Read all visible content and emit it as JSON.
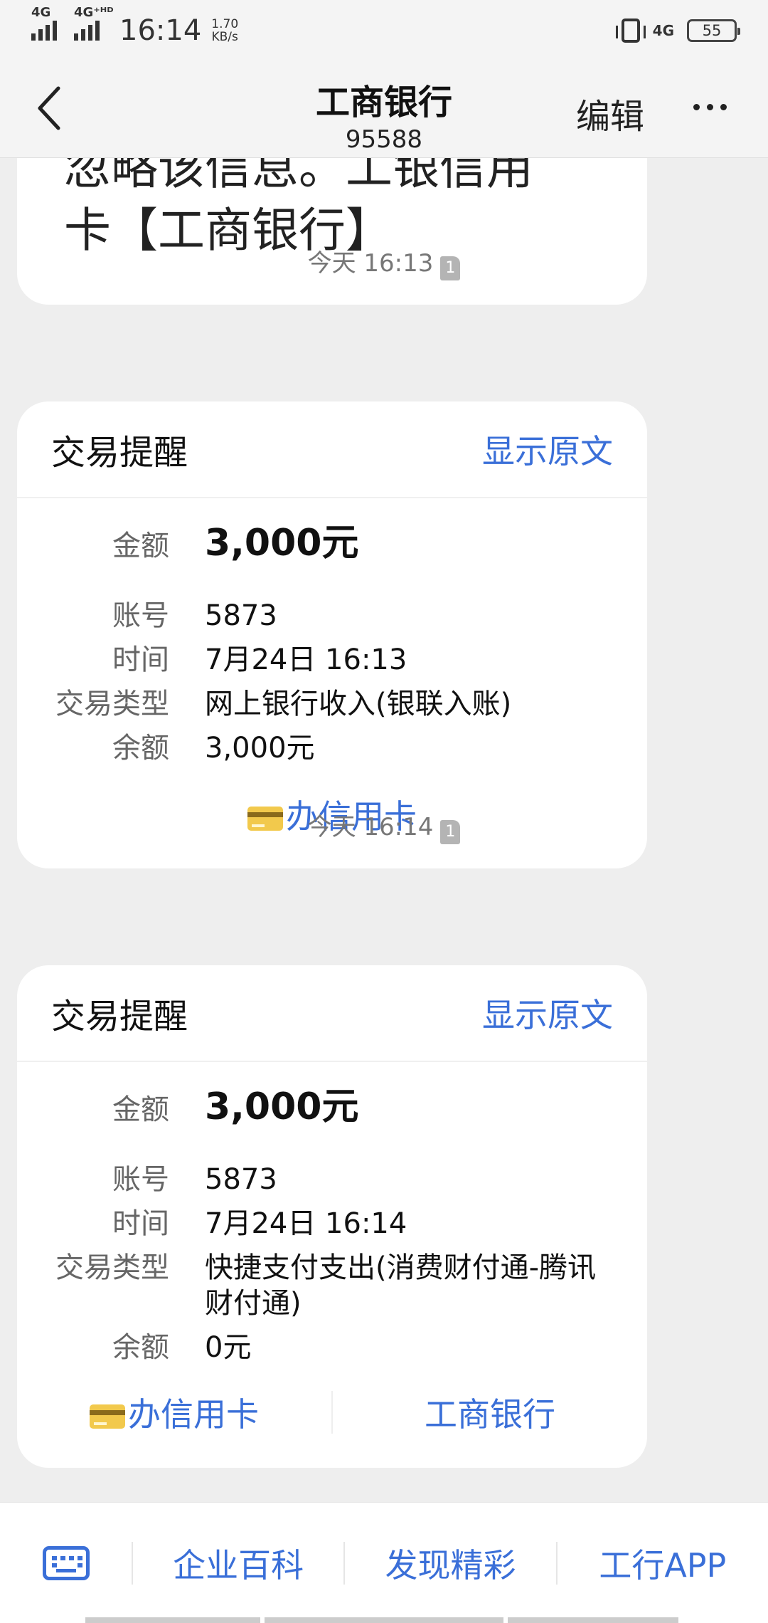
{
  "status_bar": {
    "net1": "4G",
    "net2": "4G⁺ᴴᴰ",
    "time": "16:14",
    "speed_value": "1.70",
    "speed_unit": "KB/s",
    "net3": "4G",
    "battery": "55"
  },
  "header": {
    "title": "工商银行",
    "subtitle": "95588",
    "edit_label": "编辑"
  },
  "messages": {
    "partial_text_line1": "忽略该信息。工银信用",
    "partial_text_line2": "卡【工商银行】",
    "timestamp1": "今天 16:13",
    "timestamp2": "今天 16:14",
    "sim_badge": "1"
  },
  "card1": {
    "title": "交易提醒",
    "link": "显示原文",
    "amount_label": "金额",
    "amount_value": "3,000元",
    "account_label": "账号",
    "account_value": "5873",
    "time_label": "时间",
    "time_value": "7月24日 16:13",
    "type_label": "交易类型",
    "type_value": "网上银行收入(银联入账)",
    "balance_label": "余额",
    "balance_value": "3,000元",
    "action1": "办信用卡"
  },
  "card2": {
    "title": "交易提醒",
    "link": "显示原文",
    "amount_label": "金额",
    "amount_value": "3,000元",
    "account_label": "账号",
    "account_value": "5873",
    "time_label": "时间",
    "time_value": "7月24日 16:14",
    "type_label": "交易类型",
    "type_value": "快捷支付支出(消费财付通-腾讯财付通)",
    "balance_label": "余额",
    "balance_value": "0元",
    "action1": "办信用卡",
    "action2": "工商银行"
  },
  "bottom_bar": {
    "items": [
      "企业百科",
      "发现精彩",
      "工行APP"
    ]
  },
  "colors": {
    "accent": "#3a6fd8",
    "background": "#eeeeee"
  }
}
